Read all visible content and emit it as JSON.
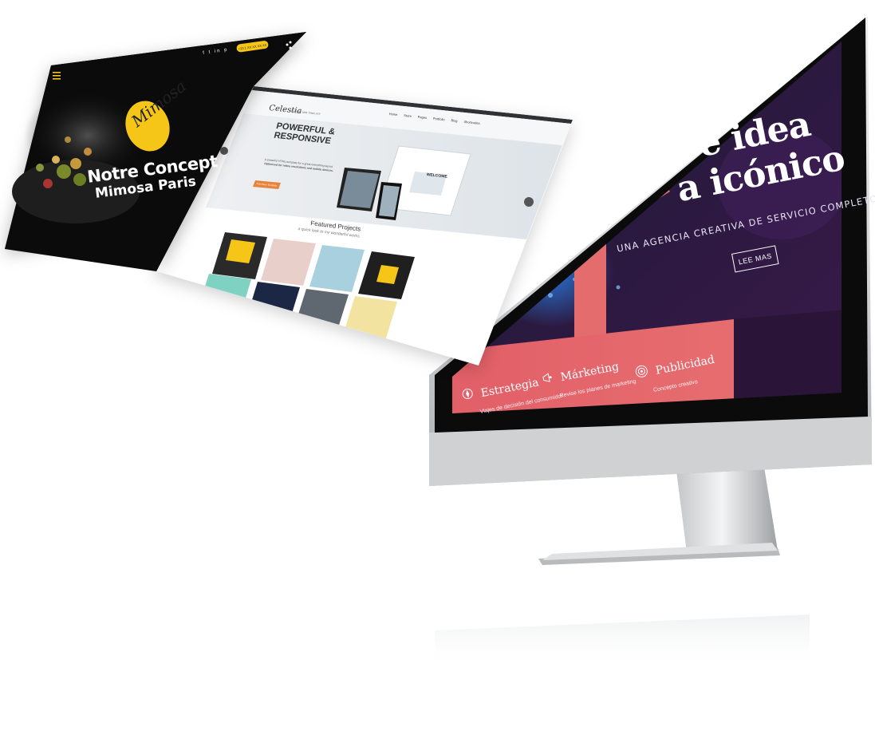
{
  "mimosa": {
    "logo": "Mimosa",
    "headline_line1": "Notre Concept",
    "headline_line2": "Mimosa Paris",
    "social": "f  t  in  p",
    "phone_label": "+33 1 XX XX XX XX"
  },
  "celestia": {
    "logo": "Celestia",
    "tagline": "PERFECT WEB TEMPLATE",
    "nav": [
      {
        "label": "Home"
      },
      {
        "label": "Store"
      },
      {
        "label": "Pages"
      },
      {
        "label": "Portfolio"
      },
      {
        "label": "Blog"
      },
      {
        "label": "Shortcodes"
      }
    ],
    "slider_title_line1": "POWERFUL &",
    "slider_title_line2": "RESPONSIVE",
    "slider_desc_line1": "A powerful HTML template for a great everything layout",
    "slider_desc_line2": "Optimized for retina resolutions and mobile devices.",
    "slider_button": "Purchase Template",
    "device_welcome": "WELCOME",
    "featured_title": "Featured Projects",
    "featured_subtitle": "a quick look to my wonderful works."
  },
  "agency": {
    "hero_line1": "De idea",
    "hero_line2": "a icónico",
    "hero_sub": "UNA AGENCIA CREATIVA DE SERVICIO COMPLETO",
    "hero_button": "LEE MAS",
    "services": [
      {
        "title": "Estrategia",
        "desc": "Viajes de decisión del consumidor",
        "icon": "compass-icon"
      },
      {
        "title": "Márketing",
        "desc": "Revise los planes de marketing",
        "icon": "megaphone-icon"
      },
      {
        "title": "Publicidad",
        "desc": "Concepto creativo",
        "icon": "target-icon"
      }
    ]
  },
  "colors": {
    "agency_dark": "#2a1538",
    "agency_coral": "#e4676d",
    "mimosa_yellow": "#f5c518",
    "celestia_orange": "#e8833a",
    "imac_silver": "#c9cbcd"
  }
}
